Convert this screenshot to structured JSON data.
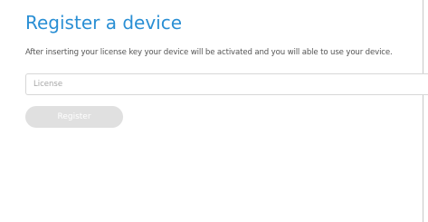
{
  "page": {
    "title": "Register a device",
    "description": "After inserting your license key your device will be activated and you will able to use your device."
  },
  "license_field": {
    "placeholder": "License",
    "value": ""
  },
  "register_button": {
    "label": "Register",
    "enabled": false
  },
  "colors": {
    "title": "#2a8fd4",
    "button_disabled_bg": "#e0e0e0",
    "border": "#d7d7d7"
  }
}
